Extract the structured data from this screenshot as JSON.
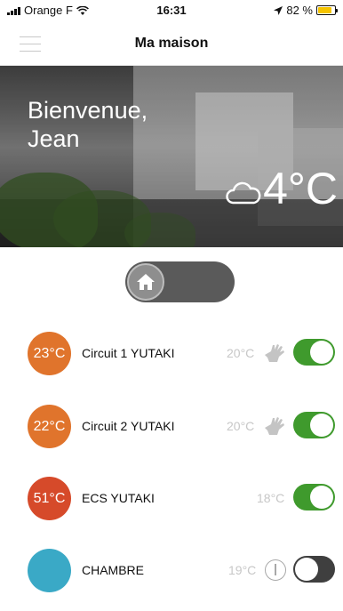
{
  "status_bar": {
    "carrier": "Orange F",
    "time": "16:31",
    "battery": "82 %",
    "battery_level": 0.82
  },
  "nav": {
    "title": "Ma maison",
    "menu_icon": "hamburger-menu-icon"
  },
  "hero": {
    "welcome_line1": "Bienvenue,",
    "welcome_line2": "Jean",
    "weather_icon": "cloud-icon",
    "outdoor_temp": "4°C"
  },
  "mode": {
    "icon": "home-icon"
  },
  "circuits": [
    {
      "temp": "23°C",
      "name": "Circuit 1 YUTAKI",
      "setpoint": "20°C",
      "mode_icon": "hand-icon",
      "on": true,
      "color": "#e0742c"
    },
    {
      "temp": "22°C",
      "name": "Circuit 2 YUTAKI",
      "setpoint": "20°C",
      "mode_icon": "hand-icon",
      "on": true,
      "color": "#e0742c"
    },
    {
      "temp": "51°C",
      "name": "ECS YUTAKI",
      "setpoint": "18°C",
      "mode_icon": "",
      "on": true,
      "color": "#d64a2a"
    },
    {
      "temp": "",
      "name": "CHAMBRE",
      "setpoint": "19°C",
      "mode_icon": "power-icon",
      "on": false,
      "color": "#3aa9c6"
    }
  ],
  "colors": {
    "switch_on": "#3f9a2d",
    "switch_off": "#3f3f3f",
    "battery": "#f5c400"
  }
}
